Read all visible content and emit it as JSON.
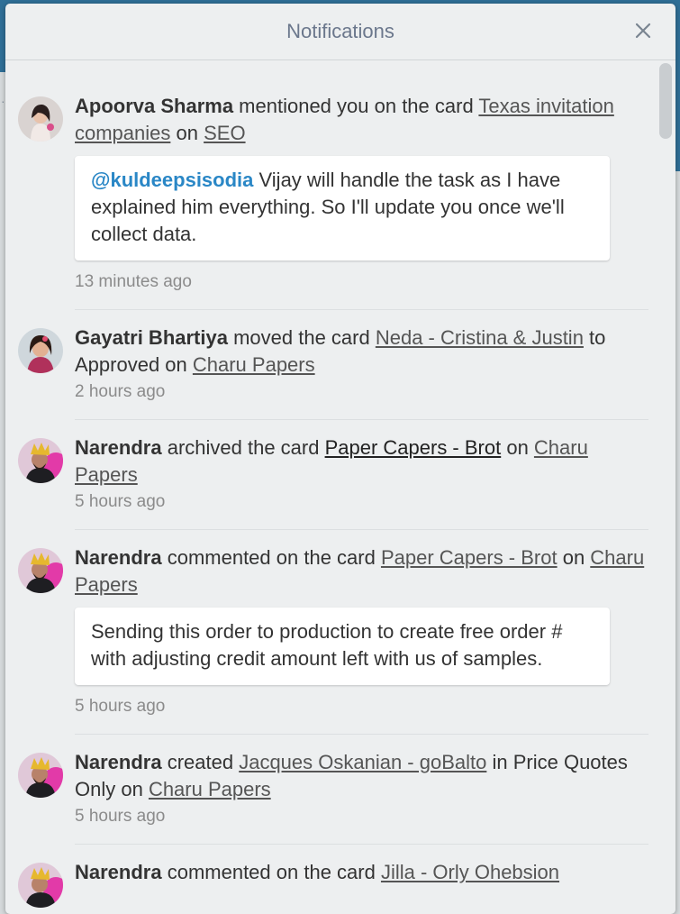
{
  "header": {
    "title": "Notifications"
  },
  "notifications": [
    {
      "actor": "Apoorva Sharma",
      "t1": " mentioned you on the card ",
      "card": "Texas invitation companies",
      "t2": " on ",
      "board": "SEO",
      "comment_mention": "@kuldeepsisodia",
      "comment_text": " Vijay will handle the task as I have explained him everything. So I'll update you once we'll collect data.",
      "time": "13 minutes ago"
    },
    {
      "actor": "Gayatri Bhartiya",
      "t1": " moved the card ",
      "card": "Neda - Cristina & Justin",
      "t2": " to Approved on ",
      "board": "Charu Papers",
      "time": "2 hours ago"
    },
    {
      "actor": "Narendra",
      "t1": " archived the card ",
      "card": "Paper Capers - Brot",
      "t2": " on ",
      "board": "Charu Papers",
      "time": "5 hours ago"
    },
    {
      "actor": "Narendra",
      "t1": " commented on the card ",
      "card": "Paper Capers - Brot",
      "t2": " on ",
      "board": "Charu Papers",
      "comment_text": "Sending this order to production to create free order # with adjusting credit amount left with us of samples.",
      "time": "5 hours ago"
    },
    {
      "actor": "Narendra",
      "t1": " created ",
      "card": "Jacques Oskanian - goBalto",
      "t2": " in Price Quotes Only on ",
      "board": "Charu Papers",
      "time": "5 hours ago"
    },
    {
      "actor": "Narendra",
      "t1": " commented on the card ",
      "card": "Jilla - Orly Ohebsion"
    }
  ]
}
